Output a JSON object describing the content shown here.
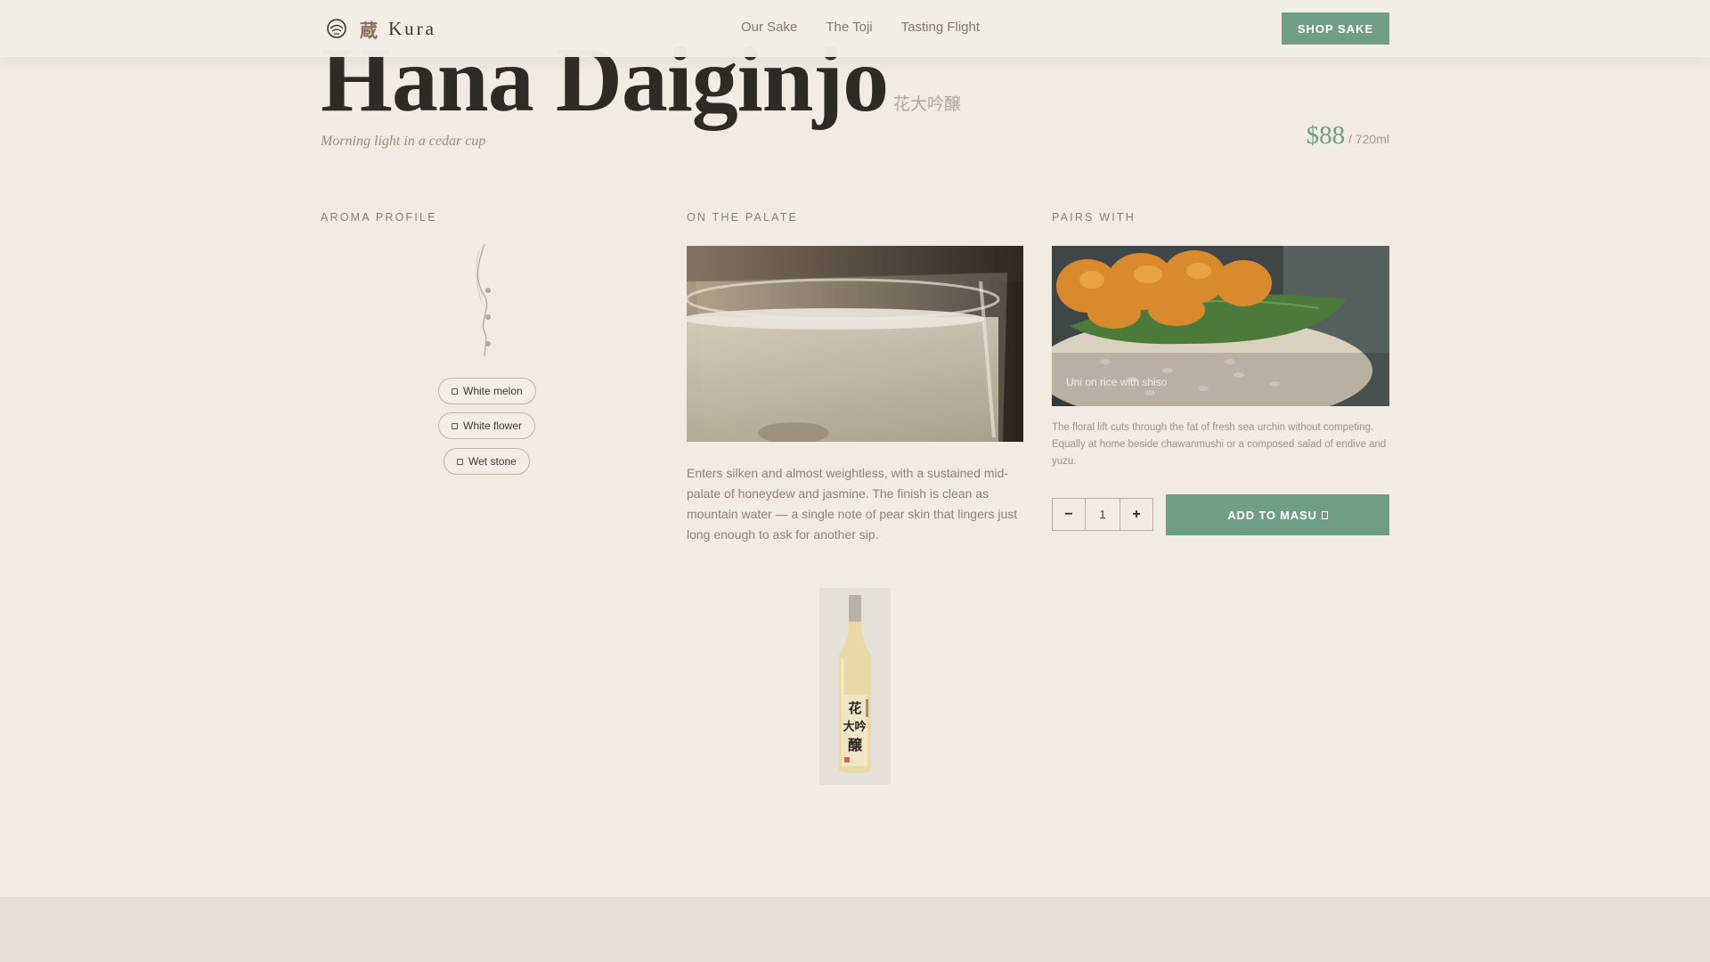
{
  "header": {
    "logo_kanji": "蔵",
    "brand": "Kura",
    "nav": [
      "Our Sake",
      "The Toji",
      "Tasting Flight"
    ],
    "cta": "SHOP SAKE"
  },
  "product": {
    "name": "Hana Daiginjo",
    "name_jp": "花大吟醸",
    "tagline": "Morning light in a cedar cup",
    "price": "$88",
    "unit": "/ 720ml"
  },
  "aroma": {
    "label": "AROMA PROFILE",
    "notes": [
      "White melon",
      "White flower",
      "Wet stone"
    ]
  },
  "palate": {
    "label": "ON THE PALATE",
    "text": "Enters silken and almost weightless, with a sustained mid-palate of honeydew and jasmine. The finish is clean as mountain water — a single note of pear skin that lingers just long enough to ask for another sip."
  },
  "pairing": {
    "label": "PAIRS WITH",
    "caption": "Uni on rice with shiso",
    "text": "The floral lift cuts through the fat of fresh sea urchin without competing. Equally at home beside chawanmushi or a composed salad of endive and yuzu."
  },
  "cart": {
    "minus": "−",
    "quantity": "1",
    "plus": "+",
    "add_label": "ADD TO MASU"
  },
  "bottle_label": "花大吟醸",
  "colors": {
    "background": "#f1ebe3",
    "accent": "#6f9e85",
    "title": "#2e2a26"
  }
}
